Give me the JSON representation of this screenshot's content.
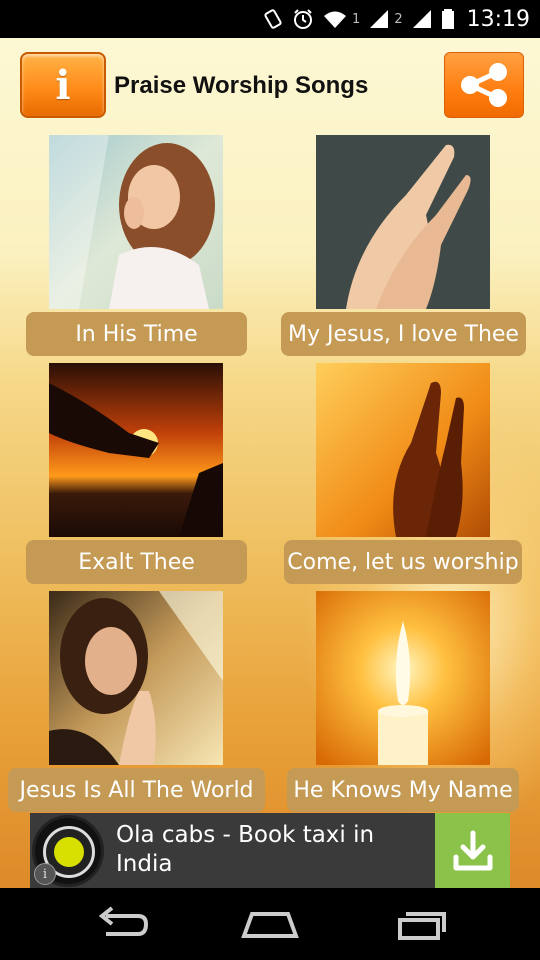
{
  "status_bar": {
    "sim1": "1",
    "sim2": "2",
    "time": "13:19"
  },
  "header": {
    "info_glyph": "i",
    "title": "Praise Worship Songs"
  },
  "songs": [
    {
      "label": "In His Time"
    },
    {
      "label": "My Jesus, I love Thee"
    },
    {
      "label": "Exalt Thee"
    },
    {
      "label": "Come, let us worship"
    },
    {
      "label": "Jesus Is All The World"
    },
    {
      "label": "He Knows My Name"
    }
  ],
  "ad": {
    "text": "Ola cabs - Book taxi in India",
    "info_glyph": "i"
  },
  "colors": {
    "accent_orange": "#ff8c1a",
    "label_bg": "#c49a55",
    "ad_download_green": "#8bc34a"
  }
}
